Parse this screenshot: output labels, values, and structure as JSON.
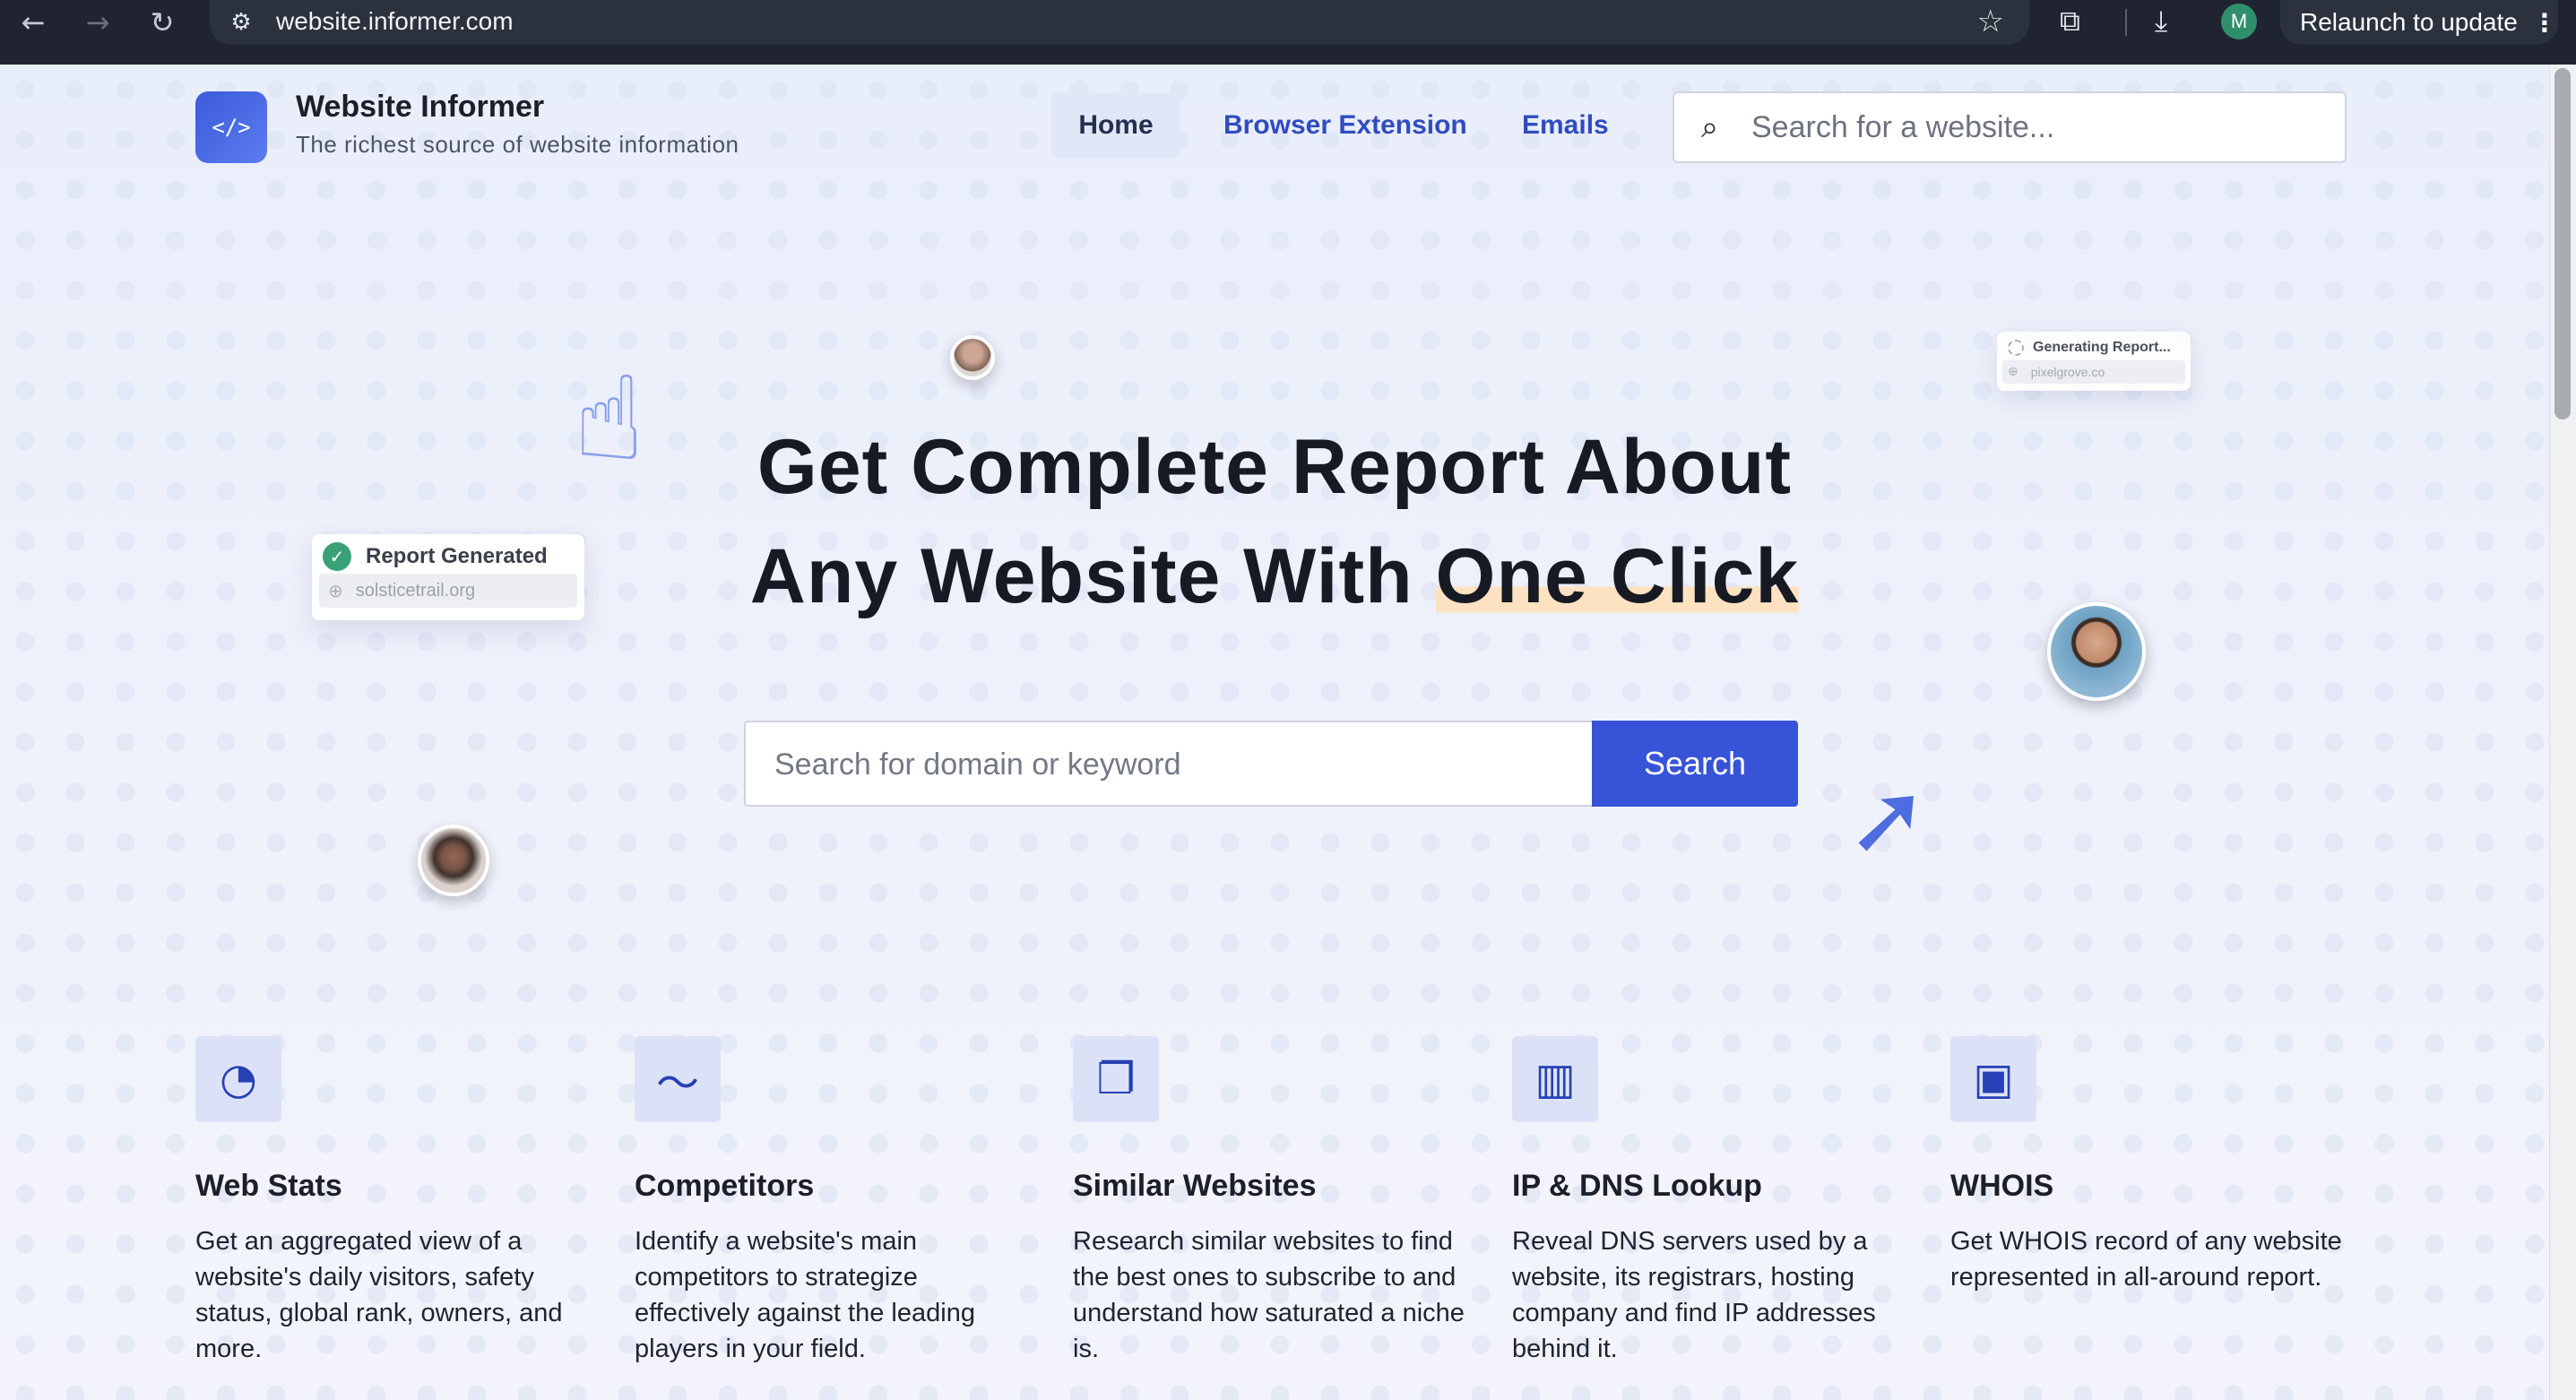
{
  "browser": {
    "url": "website.informer.com",
    "profile_initial": "M",
    "relaunch_label": "Relaunch to update"
  },
  "header": {
    "brand_name": "Website Informer",
    "brand_tagline": "The richest source of website information",
    "logo_glyph": "</>",
    "nav": [
      "Home",
      "Browser Extension",
      "Emails"
    ],
    "search_placeholder": "Search for a website..."
  },
  "hero": {
    "title_line1": "Get Complete Report About",
    "title_line2_plain": "Any Website With ",
    "title_line2_highlight": "One Click",
    "search_placeholder": "Search for domain or keyword",
    "search_button": "Search",
    "card_report": {
      "status": "Report Generated",
      "domain": "solsticetrail.org"
    },
    "card_generating": {
      "status": "Generating Report...",
      "domain": "pixelgrove.co"
    }
  },
  "features": [
    {
      "icon": "pie-chart-icon",
      "title": "Web Stats",
      "desc": "Get an aggregated view of a website's daily visitors, safety status, global rank, owners, and more."
    },
    {
      "icon": "trend-line-icon",
      "title": "Competitors",
      "desc": "Identify a website's main competitors to strategize effectively against the leading players in your field."
    },
    {
      "icon": "stacked-squares-icon",
      "title": "Similar Websites",
      "desc": "Research similar websites to find the best ones to subscribe to and understand how saturated a niche is."
    },
    {
      "icon": "columns-icon",
      "title": "IP & DNS Lookup",
      "desc": "Reveal DNS servers used by a website, its registrars, hosting company and find IP addresses behind it."
    },
    {
      "icon": "id-badge-icon",
      "title": "WHOIS",
      "desc": "Get WHOIS record of any website represented in all-around report."
    }
  ]
}
